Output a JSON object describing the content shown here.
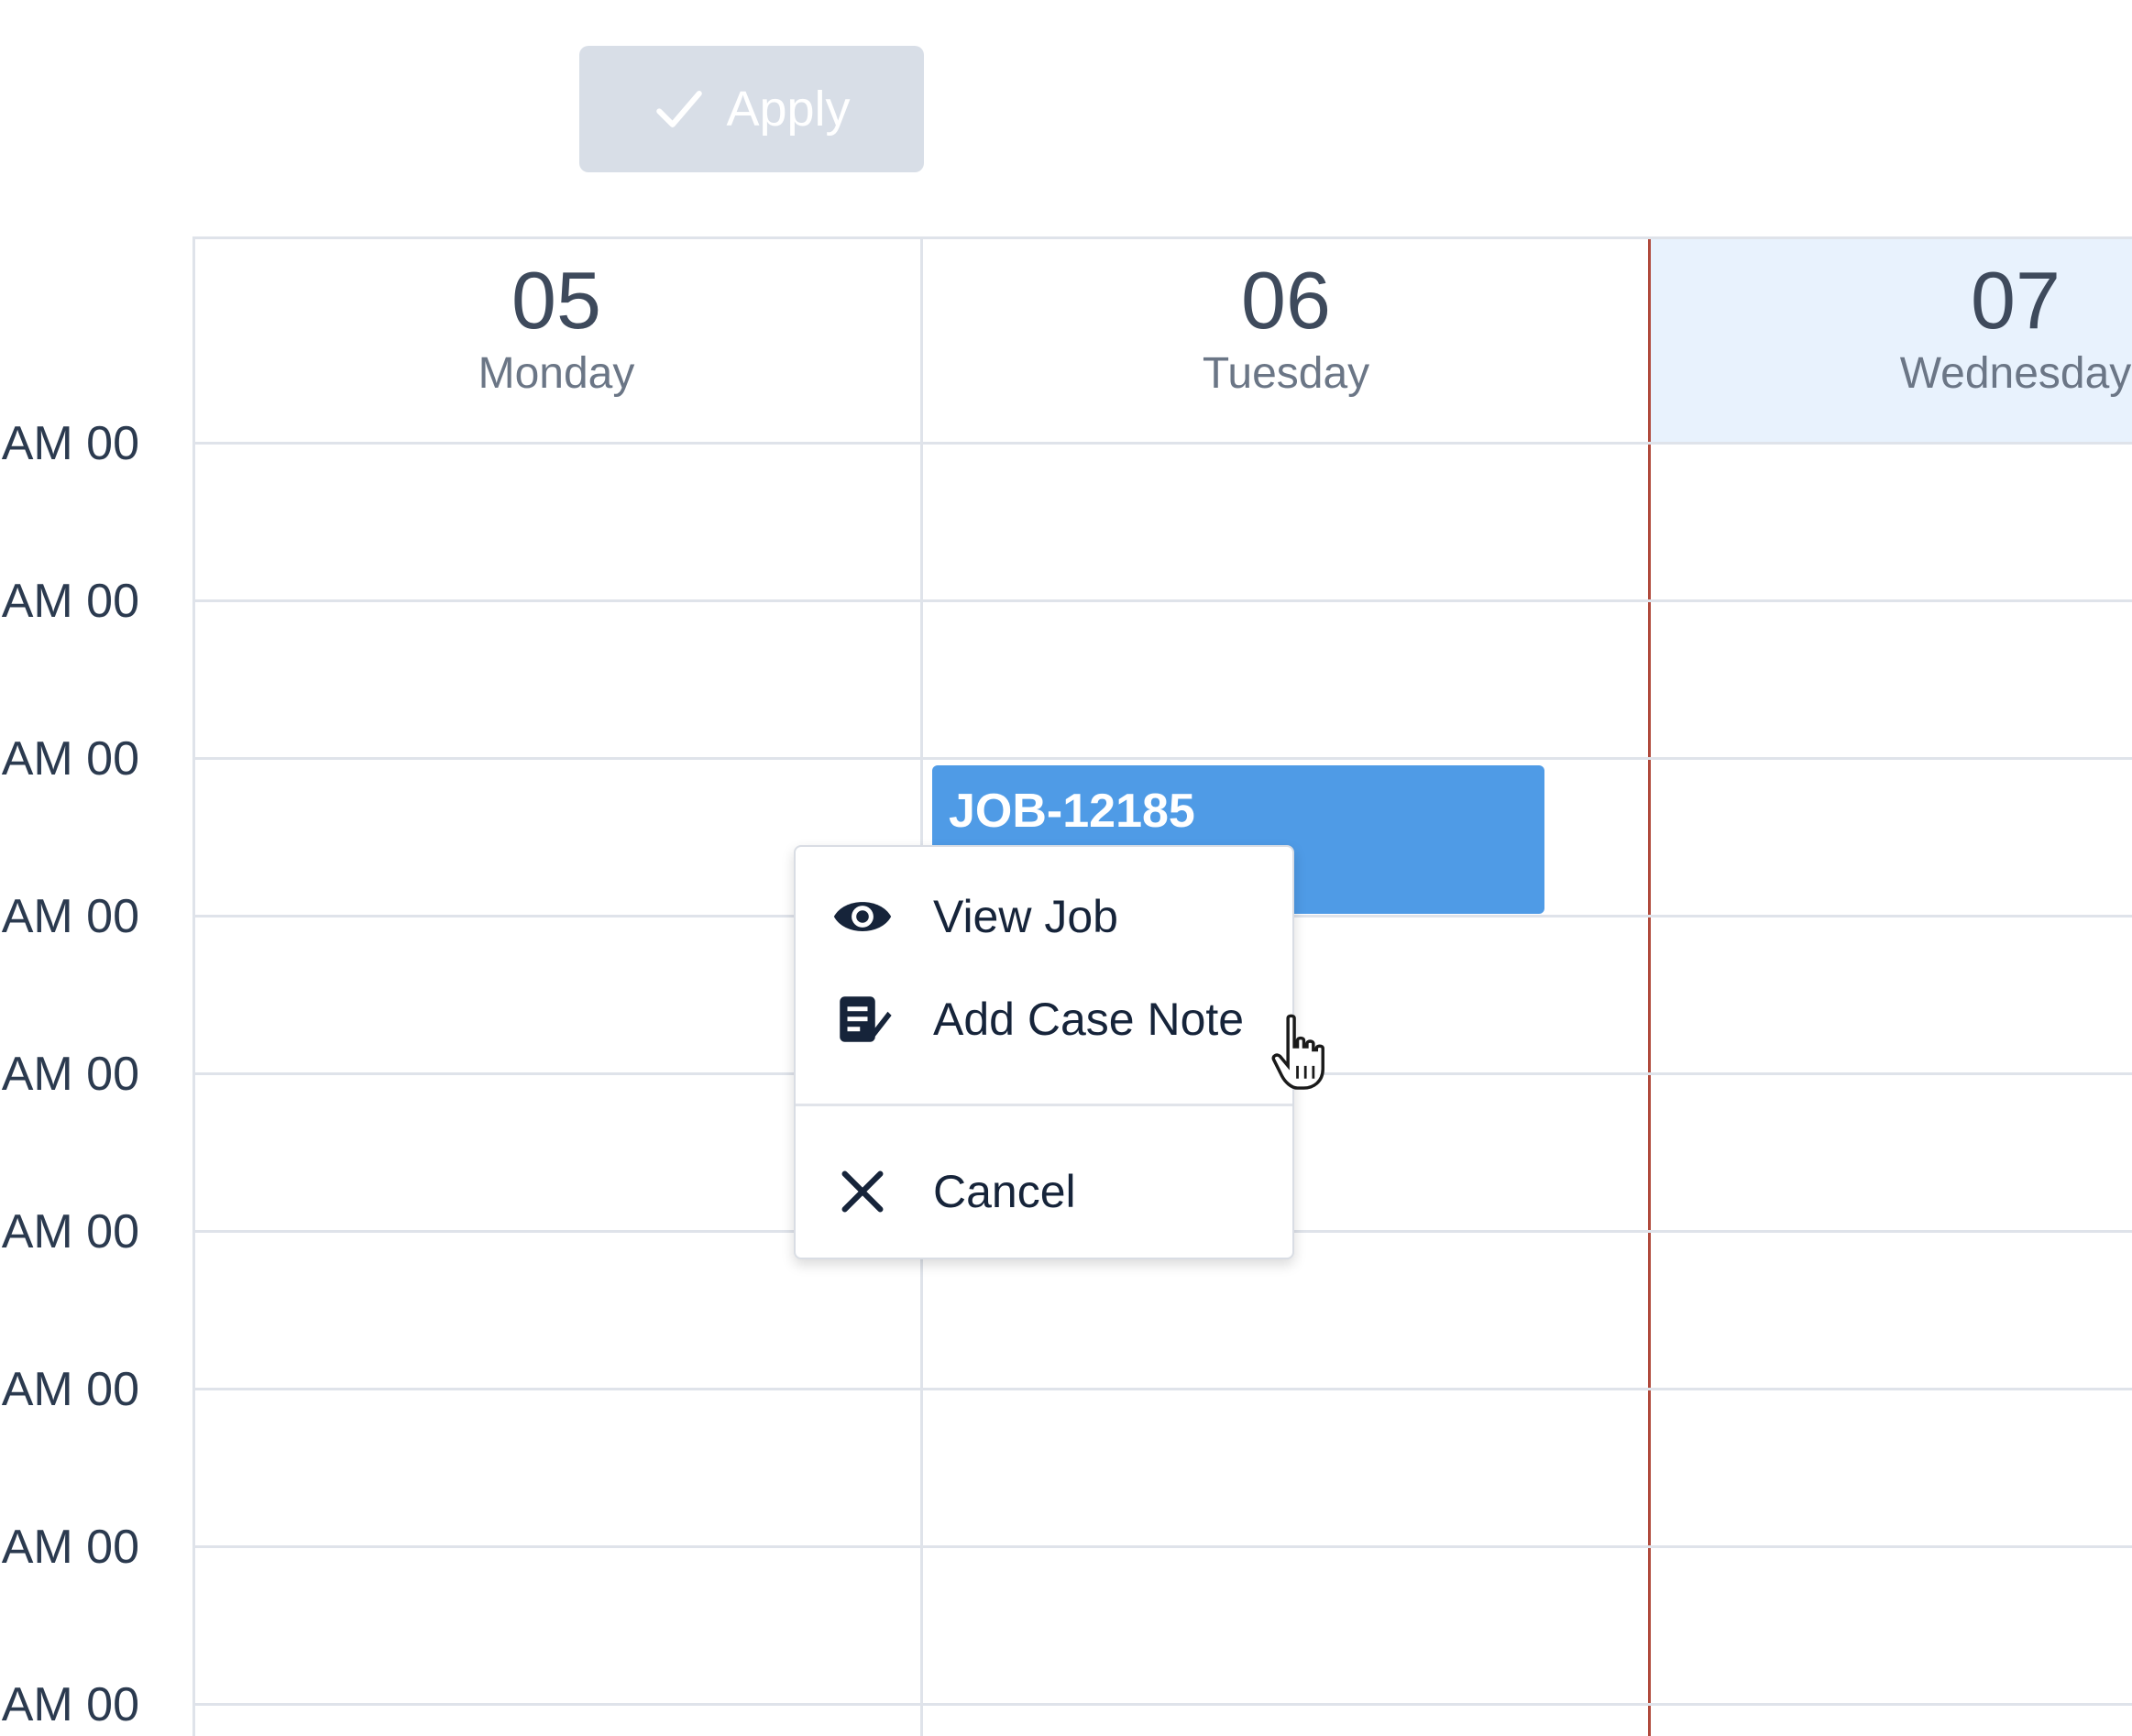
{
  "toolbar": {
    "apply_label": "Apply"
  },
  "time_labels": [
    "00 AM",
    "00 AM",
    "00 AM",
    "00 AM",
    "00 AM",
    "00 AM",
    "00 AM",
    "00 AM",
    "00 AM"
  ],
  "days": [
    {
      "number": "05",
      "name": "Monday"
    },
    {
      "number": "06",
      "name": "Tuesday"
    },
    {
      "number": "07",
      "name": "Wednesday"
    }
  ],
  "event": {
    "title": "JOB-12185"
  },
  "context_menu": {
    "items": [
      {
        "label": "View Job",
        "icon": "eye-icon"
      },
      {
        "label": "Add Case Note",
        "icon": "case-note-icon"
      },
      {
        "label": "Cancel",
        "icon": "close-icon"
      }
    ]
  },
  "colors": {
    "event": "#4f9be6",
    "today_line": "#b04a3c",
    "today_header": "#e8f2fd",
    "apply_disabled": "#d8dee7"
  }
}
